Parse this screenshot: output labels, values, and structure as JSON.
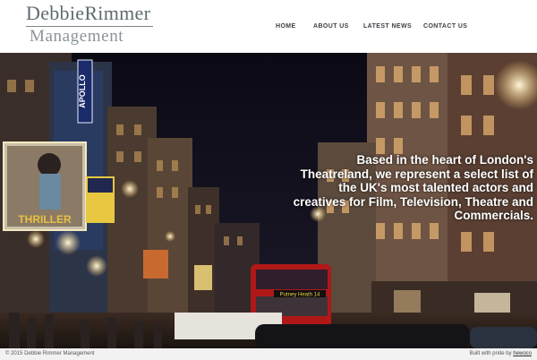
{
  "brand": {
    "line1": "DebbieRimmer",
    "line2": "Management"
  },
  "nav": {
    "home": "HOME",
    "about": "ABOUT US",
    "news": "LATEST NEWS",
    "contact": "CONTACT US"
  },
  "hero": {
    "tagline": "Based in the heart of London's Theatreland, we represent a select list of the UK's most talented actors and creatives for Film, Television, Theatre and Commercials.",
    "signs": {
      "apollo": "APOLLO",
      "thriller": "THRILLER",
      "bus_destination": "Putney Heath 14"
    }
  },
  "footer": {
    "copyright": "© 2015 Debbie Rimmer Management",
    "credit_prefix": "Built with pride by ",
    "credit_link": "hewoco"
  },
  "colors": {
    "header_bg": "#ffffff",
    "logo_text": "#5f6b70",
    "nav_text": "#3a3f44",
    "footer_bg": "#f2f2f2",
    "tagline_text": "#ffffff"
  }
}
